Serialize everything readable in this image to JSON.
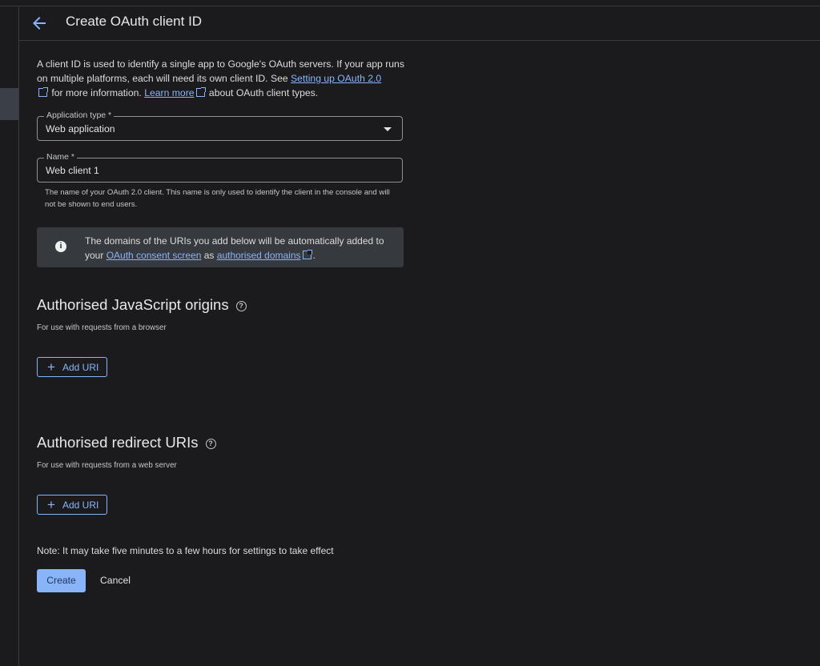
{
  "header": {
    "title": "Create OAuth client ID"
  },
  "intro": {
    "part1": "A client ID is used to identify a single app to Google's OAuth servers. If your app runs on multiple platforms, each will need its own client ID. See ",
    "link1": "Setting up OAuth 2.0",
    "part2": " for more information. ",
    "link2": "Learn more",
    "part3": " about OAuth client types."
  },
  "application_type": {
    "label": "Application type *",
    "value": "Web application"
  },
  "name_field": {
    "label": "Name *",
    "value": "Web client 1"
  },
  "name_hint": "The name of your OAuth 2.0 client. This name is only used to identify the client in the console and will not be shown to end users.",
  "info": {
    "part1": "The domains of the URIs you add below will be automatically added to your ",
    "link1": "OAuth consent screen",
    "part2": " as ",
    "link2": "authorised domains",
    "part3": "."
  },
  "js_origins": {
    "title": "Authorised JavaScript origins",
    "subtitle": "For use with requests from a browser",
    "add_label": "Add URI"
  },
  "redirect_uris": {
    "title": "Authorised redirect URIs",
    "subtitle": "For use with requests from a web server",
    "add_label": "Add URI"
  },
  "note": "Note: It may take five minutes to a few hours for settings to take effect",
  "actions": {
    "create": "Create",
    "cancel": "Cancel"
  },
  "colors": {
    "accent": "#8ab4f8",
    "background": "#1b1b1d",
    "info_box": "#36393d"
  }
}
